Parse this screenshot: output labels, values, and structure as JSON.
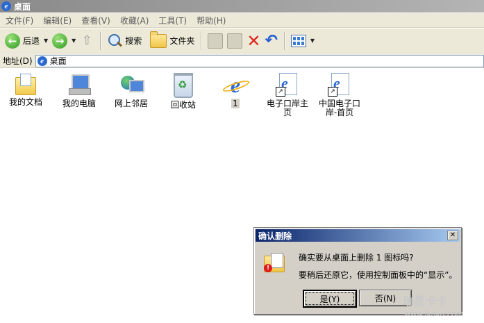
{
  "window": {
    "title": "桌面"
  },
  "menu": [
    "文件(F)",
    "编辑(E)",
    "查看(V)",
    "收藏(A)",
    "工具(T)",
    "帮助(H)"
  ],
  "toolbar": {
    "back_label": "后退",
    "search_label": "搜索",
    "folders_label": "文件夹"
  },
  "address": {
    "label": "地址(D)",
    "value": "桌面"
  },
  "desktop_icons": [
    {
      "label": "我的文档",
      "icon": "my-documents-icon"
    },
    {
      "label": "我的电脑",
      "icon": "my-computer-icon"
    },
    {
      "label": "网上邻居",
      "icon": "network-places-icon"
    },
    {
      "label": "回收站",
      "icon": "recycle-bin-icon"
    },
    {
      "label": "1",
      "icon": "internet-explorer-icon"
    },
    {
      "label": "电子口岸主页",
      "icon": "ie-shortcut-icon"
    },
    {
      "label": "中国电子口岸-首页",
      "icon": "ie-shortcut-icon"
    }
  ],
  "dialog": {
    "title": "确认删除",
    "close": "✕",
    "message": "确实要从桌面上删除 1 图标吗?",
    "hint": "要稍后还原它，使用控制面板中的“显示”。",
    "yes_label": "是(Y)",
    "no_label": "否(N)"
  },
  "watermark": {
    "brand": "瑞星卡卡",
    "url": "www.ikaka.com"
  }
}
